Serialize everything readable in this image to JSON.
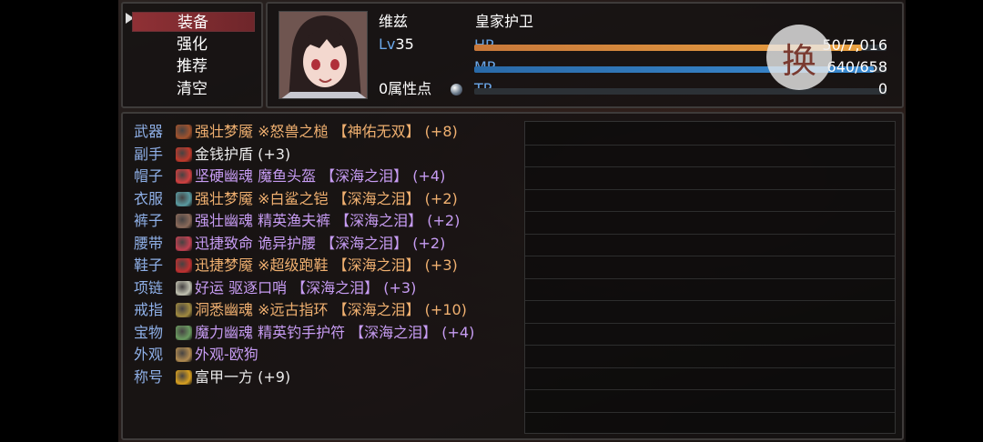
{
  "menu": {
    "items": [
      {
        "label": "装备",
        "selected": true
      },
      {
        "label": "强化",
        "selected": false
      },
      {
        "label": "推荐",
        "selected": false
      },
      {
        "label": "清空",
        "selected": false
      }
    ]
  },
  "character": {
    "name": "维兹",
    "class": "皇家护卫",
    "level_prefix": "Lv",
    "level": "35",
    "hp_label": "HP",
    "hp_value": "50/7,016",
    "mp_label": "MP",
    "mp_value": "640/658",
    "tp_label": "TP",
    "tp_value": "0",
    "attribute_points": "0属性点",
    "hp_fraction": 0.94,
    "mp_fraction": 0.97,
    "tp_fraction": 0
  },
  "switch_button": {
    "label": "换"
  },
  "equipment": [
    {
      "slot": "武器",
      "text": "强壮梦魇 ※怒兽之槌 【神佑无双】 (+8)",
      "tone": "orange",
      "icon": "hammer-icon",
      "icon_color": "#a0522d"
    },
    {
      "slot": "副手",
      "text": "金钱护盾 (+3)",
      "tone": "white",
      "icon": "shield-icon",
      "icon_color": "#c0392b"
    },
    {
      "slot": "帽子",
      "text": "坚硬幽魂 魔鱼头盔 【深海之泪】 (+4)",
      "tone": "purple",
      "icon": "helmet-icon",
      "icon_color": "#d04040"
    },
    {
      "slot": "衣服",
      "text": "强壮梦魇 ※白鲨之铠 【深海之泪】 (+2)",
      "tone": "orange",
      "icon": "armor-icon",
      "icon_color": "#5a9aa0"
    },
    {
      "slot": "裤子",
      "text": "强壮幽魂 精英渔夫裤 【深海之泪】 (+2)",
      "tone": "purple",
      "icon": "pants-icon",
      "icon_color": "#8a6a5a"
    },
    {
      "slot": "腰带",
      "text": "迅捷致命 诡异护腰 【深海之泪】 (+2)",
      "tone": "purple",
      "icon": "belt-icon",
      "icon_color": "#c04050"
    },
    {
      "slot": "鞋子",
      "text": "迅捷梦魇 ※超级跑鞋 【深海之泪】 (+3)",
      "tone": "orange",
      "icon": "boots-icon",
      "icon_color": "#c03030"
    },
    {
      "slot": "项链",
      "text": "好运 驱逐口哨 【深海之泪】 (+3)",
      "tone": "purple",
      "icon": "whistle-icon",
      "icon_color": "#c0c0b0"
    },
    {
      "slot": "戒指",
      "text": "洞悉幽魂 ※远古指环 【深海之泪】 (+10)",
      "tone": "orange",
      "icon": "ring-icon",
      "icon_color": "#a08a40"
    },
    {
      "slot": "宝物",
      "text": "魔力幽魂 精英钓手护符 【深海之泪】 (+4)",
      "tone": "purple",
      "icon": "amulet-icon",
      "icon_color": "#6a9a60"
    },
    {
      "slot": "外观",
      "text": "外观-欧狗",
      "tone": "purple",
      "icon": "figure-icon",
      "icon_color": "#b08a50"
    },
    {
      "slot": "称号",
      "text": "富甲一方 (+9)",
      "tone": "white",
      "icon": "medal-icon",
      "icon_color": "#d8a020"
    }
  ],
  "colors": {
    "hp_bar": "#e8a040",
    "mp_bar": "#3a8ad0",
    "slot_label": "#8fb0e8",
    "orange_item": "#f0b070",
    "purple_item": "#c79cf3",
    "menu_selected": "#963237"
  }
}
